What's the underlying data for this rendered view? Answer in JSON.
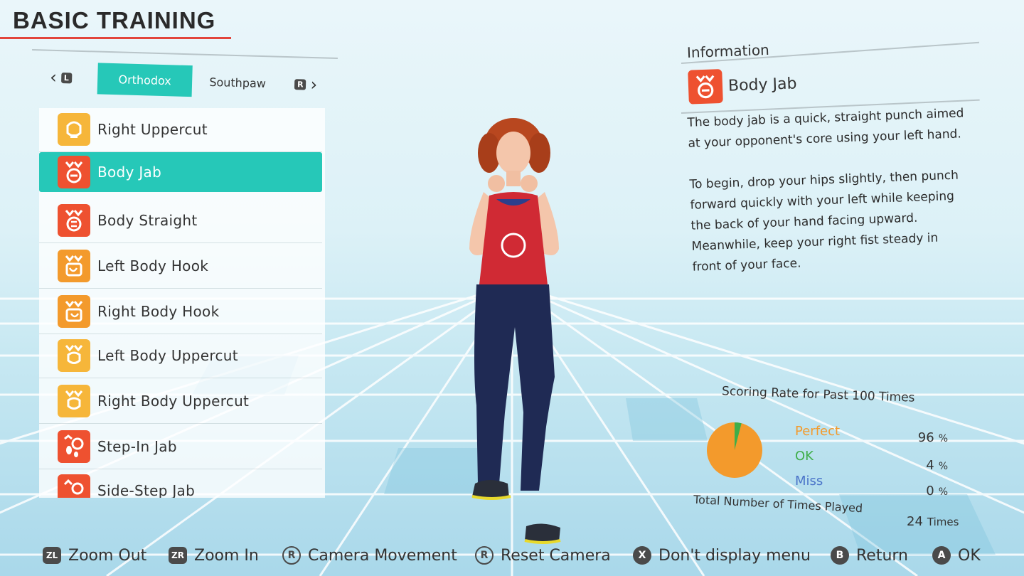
{
  "header": {
    "title": "BASIC TRAINING"
  },
  "tabs": {
    "prev_key": "L",
    "next_key": "R",
    "items": [
      {
        "label": "Orthodox",
        "active": true
      },
      {
        "label": "Southpaw",
        "active": false
      }
    ]
  },
  "moves": [
    {
      "label": "Right Uppercut",
      "icon": "uppercut-icon",
      "color": "#f6b63a",
      "selected": false
    },
    {
      "label": "Body Jab",
      "icon": "body-jab-icon",
      "color": "#ee5130",
      "selected": true
    },
    {
      "label": "Body Straight",
      "icon": "body-straight-icon",
      "color": "#ee5130",
      "selected": false
    },
    {
      "label": "Left Body Hook",
      "icon": "body-hook-icon",
      "color": "#f39a2c",
      "selected": false
    },
    {
      "label": "Right Body Hook",
      "icon": "body-hook-icon",
      "color": "#f39a2c",
      "selected": false
    },
    {
      "label": "Left Body Uppercut",
      "icon": "body-uppercut-icon",
      "color": "#f6b63a",
      "selected": false
    },
    {
      "label": "Right Body Uppercut",
      "icon": "body-uppercut-icon",
      "color": "#f6b63a",
      "selected": false
    },
    {
      "label": "Step-In Jab",
      "icon": "step-in-icon",
      "color": "#ee5130",
      "selected": false
    },
    {
      "label": "Side-Step Jab",
      "icon": "side-step-icon",
      "color": "#ee5130",
      "selected": false
    }
  ],
  "info": {
    "heading": "Information",
    "title": "Body Jab",
    "description": "The body jab is a quick, straight punch aimed at your opponent's core using your left hand.\n\nTo begin, drop your hips slightly, then punch forward quickly with your left while keeping the back of your hand facing upward. Meanwhile, keep your right fist steady in front of your face."
  },
  "scoring": {
    "title": "Scoring Rate for Past 100 Times",
    "rows": [
      {
        "label": "Perfect",
        "value": "96",
        "unit": "%",
        "color": "#f39a2c"
      },
      {
        "label": "OK",
        "value": "4",
        "unit": "%",
        "color": "#3fae49"
      },
      {
        "label": "Miss",
        "value": "0",
        "unit": "%",
        "color": "#4b74c9"
      }
    ],
    "total_label": "Total Number of Times Played",
    "total_value": "24",
    "total_unit": "Times"
  },
  "controls": [
    {
      "key": "ZL",
      "label": "Zoom Out"
    },
    {
      "key": "ZR",
      "label": "Zoom In"
    },
    {
      "key": "R",
      "label": "Camera Movement"
    },
    {
      "key": "R",
      "label": "Reset Camera"
    },
    {
      "key": "X",
      "label": "Don't display menu"
    },
    {
      "key": "B",
      "label": "Return"
    },
    {
      "key": "A",
      "label": "OK"
    }
  ]
}
